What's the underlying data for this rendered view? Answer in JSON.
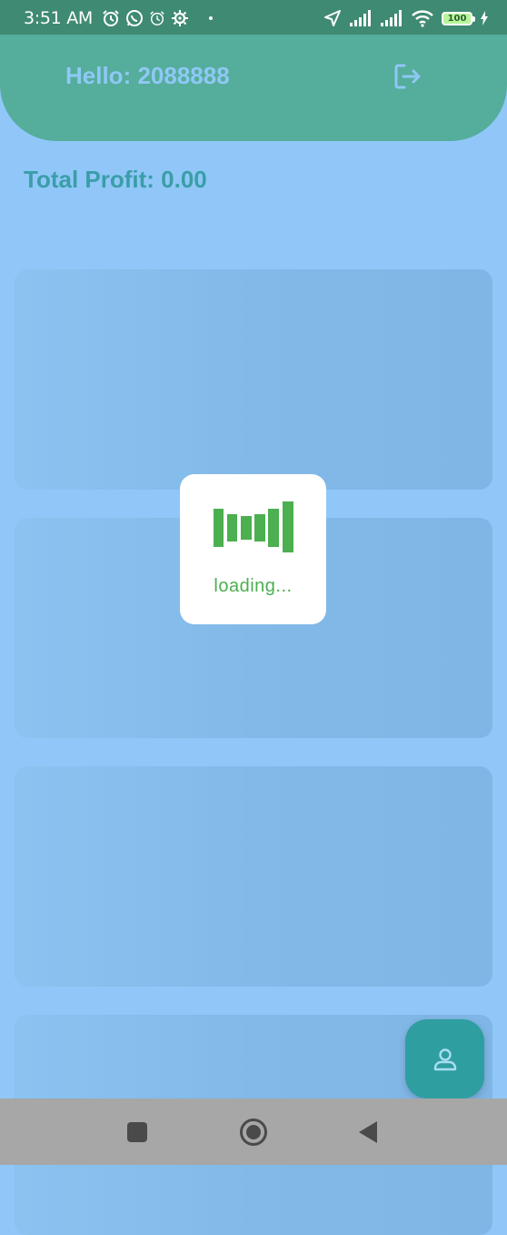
{
  "status_bar": {
    "time": "3:51 AM",
    "battery": "100",
    "icons": [
      "alarm-icon",
      "whatsapp-icon",
      "alarm-icon",
      "settings-icon",
      "location-arrow-icon",
      "signal-icon",
      "signal-icon",
      "wifi-icon",
      "battery-icon",
      "charging-icon"
    ]
  },
  "header": {
    "greeting": "Hello: 2088888",
    "logout_icon": "logout-icon",
    "background_color": "#55ad9b"
  },
  "summary": {
    "total_profit": "Total Profit: 0.00"
  },
  "loading": {
    "text": "loading...",
    "color": "#4caf50"
  },
  "fab": {
    "icon": "person-icon",
    "color": "#2f9ea0"
  },
  "nav_bar": {
    "buttons": [
      "recents-square-icon",
      "home-circle-icon",
      "back-triangle-icon"
    ]
  },
  "colors": {
    "page_background": "#90c7f8",
    "status_bar": "#3f8a72"
  }
}
